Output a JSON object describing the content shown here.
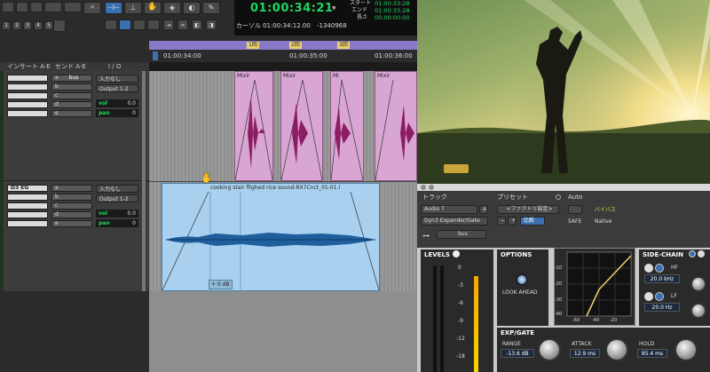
{
  "toolbar": {
    "counter_main": "01:00:34:21",
    "counter_arrow": "▼",
    "cursor_label": "カーソル",
    "cursor_value": "01:00:34:12.00",
    "sample_offset": "-1340968",
    "start_label": "スタート",
    "end_label": "エンド",
    "length_label": "長さ",
    "start_value": "01:00:33:28",
    "end_value": "01:00:33:28",
    "length_value": "00:00:00:00",
    "grid_numbers": [
      "1",
      "2",
      "3",
      "4",
      "5"
    ]
  },
  "ruler": {
    "ticks": [
      "01:00:34:00",
      "01:00:35:00",
      "01:00:36:00"
    ],
    "markers": [
      "1回",
      "2回",
      "3回"
    ]
  },
  "columns": {
    "inserts": "インサート A-E",
    "sends": "センド A-E",
    "io": "I / O"
  },
  "track1": {
    "inserts": [
      "",
      "",
      "",
      "",
      ""
    ],
    "send_letters": [
      "a",
      "b",
      "c",
      "d",
      "e"
    ],
    "send_a_name": "bus",
    "input": "入力なし",
    "output": "Output 1-2",
    "vol_label": "vol",
    "vol_value": "0.0",
    "pan_label": "pan",
    "pan_value": "0"
  },
  "track2": {
    "inserts": [
      "D3 EG",
      "",
      "",
      "",
      ""
    ],
    "send_letters": [
      "a",
      "b",
      "c",
      "d",
      "e"
    ],
    "input": "入力なし",
    "output": "Output 1-2",
    "vol_label": "vol",
    "vol_value": "0.0",
    "pan_label": "pan",
    "pan_value": "0"
  },
  "clips": {
    "pink_names": [
      "Mixir",
      "Mixir",
      "Mi",
      "Mixir"
    ],
    "blue_name": "cooking stair flighed rice sound-RX7Cnct_01-01.l",
    "blue_gain": "+ 0 dB"
  },
  "plugin": {
    "track_header": "トラック",
    "preset_header": "プリセット",
    "auto_header": "Auto",
    "track_name": "Audio 7",
    "track_letter": "a",
    "preset_name": "<ファクトリ設定>",
    "plugin_name": "Dyn3 Expander/Gate",
    "compare_label": "比較",
    "minus": "−",
    "plus": "+",
    "safe_label": "SAFE",
    "bypass_label": "バイパス",
    "native_label": "Native",
    "key_input": "bus",
    "levels_label": "LEVELS",
    "options_label": "OPTIONS",
    "lookahead_label": "LOOK AHEAD",
    "sidechain_label": "SIDE-CHAIN",
    "hf_label": "HF",
    "hf_value": "20.0 kHz",
    "lf_label": "LF",
    "lf_value": "20.0 Hz",
    "expgate_label": "EXP/GATE",
    "range_label": "RANGE",
    "range_value": "-13.6 dB",
    "attack_label": "ATTACK",
    "attack_value": "12.9 ms",
    "hold_label": "HOLD",
    "hold_value": "85.4 ms",
    "meter_scale": [
      "0",
      "-3",
      "-6",
      "-9",
      "-12",
      "-18"
    ],
    "graph_scale": [
      "-10",
      "-20",
      "-30",
      "-40"
    ],
    "graph_bottom": [
      "-60",
      "-40",
      "-20"
    ]
  },
  "colors": {
    "counter_green": "#1ed760",
    "clip_pink": "#d9a6d4",
    "clip_blue": "#a9d1ef",
    "marker_purple": "#8a79c9",
    "plugin_blue": "#3a6fb0"
  }
}
